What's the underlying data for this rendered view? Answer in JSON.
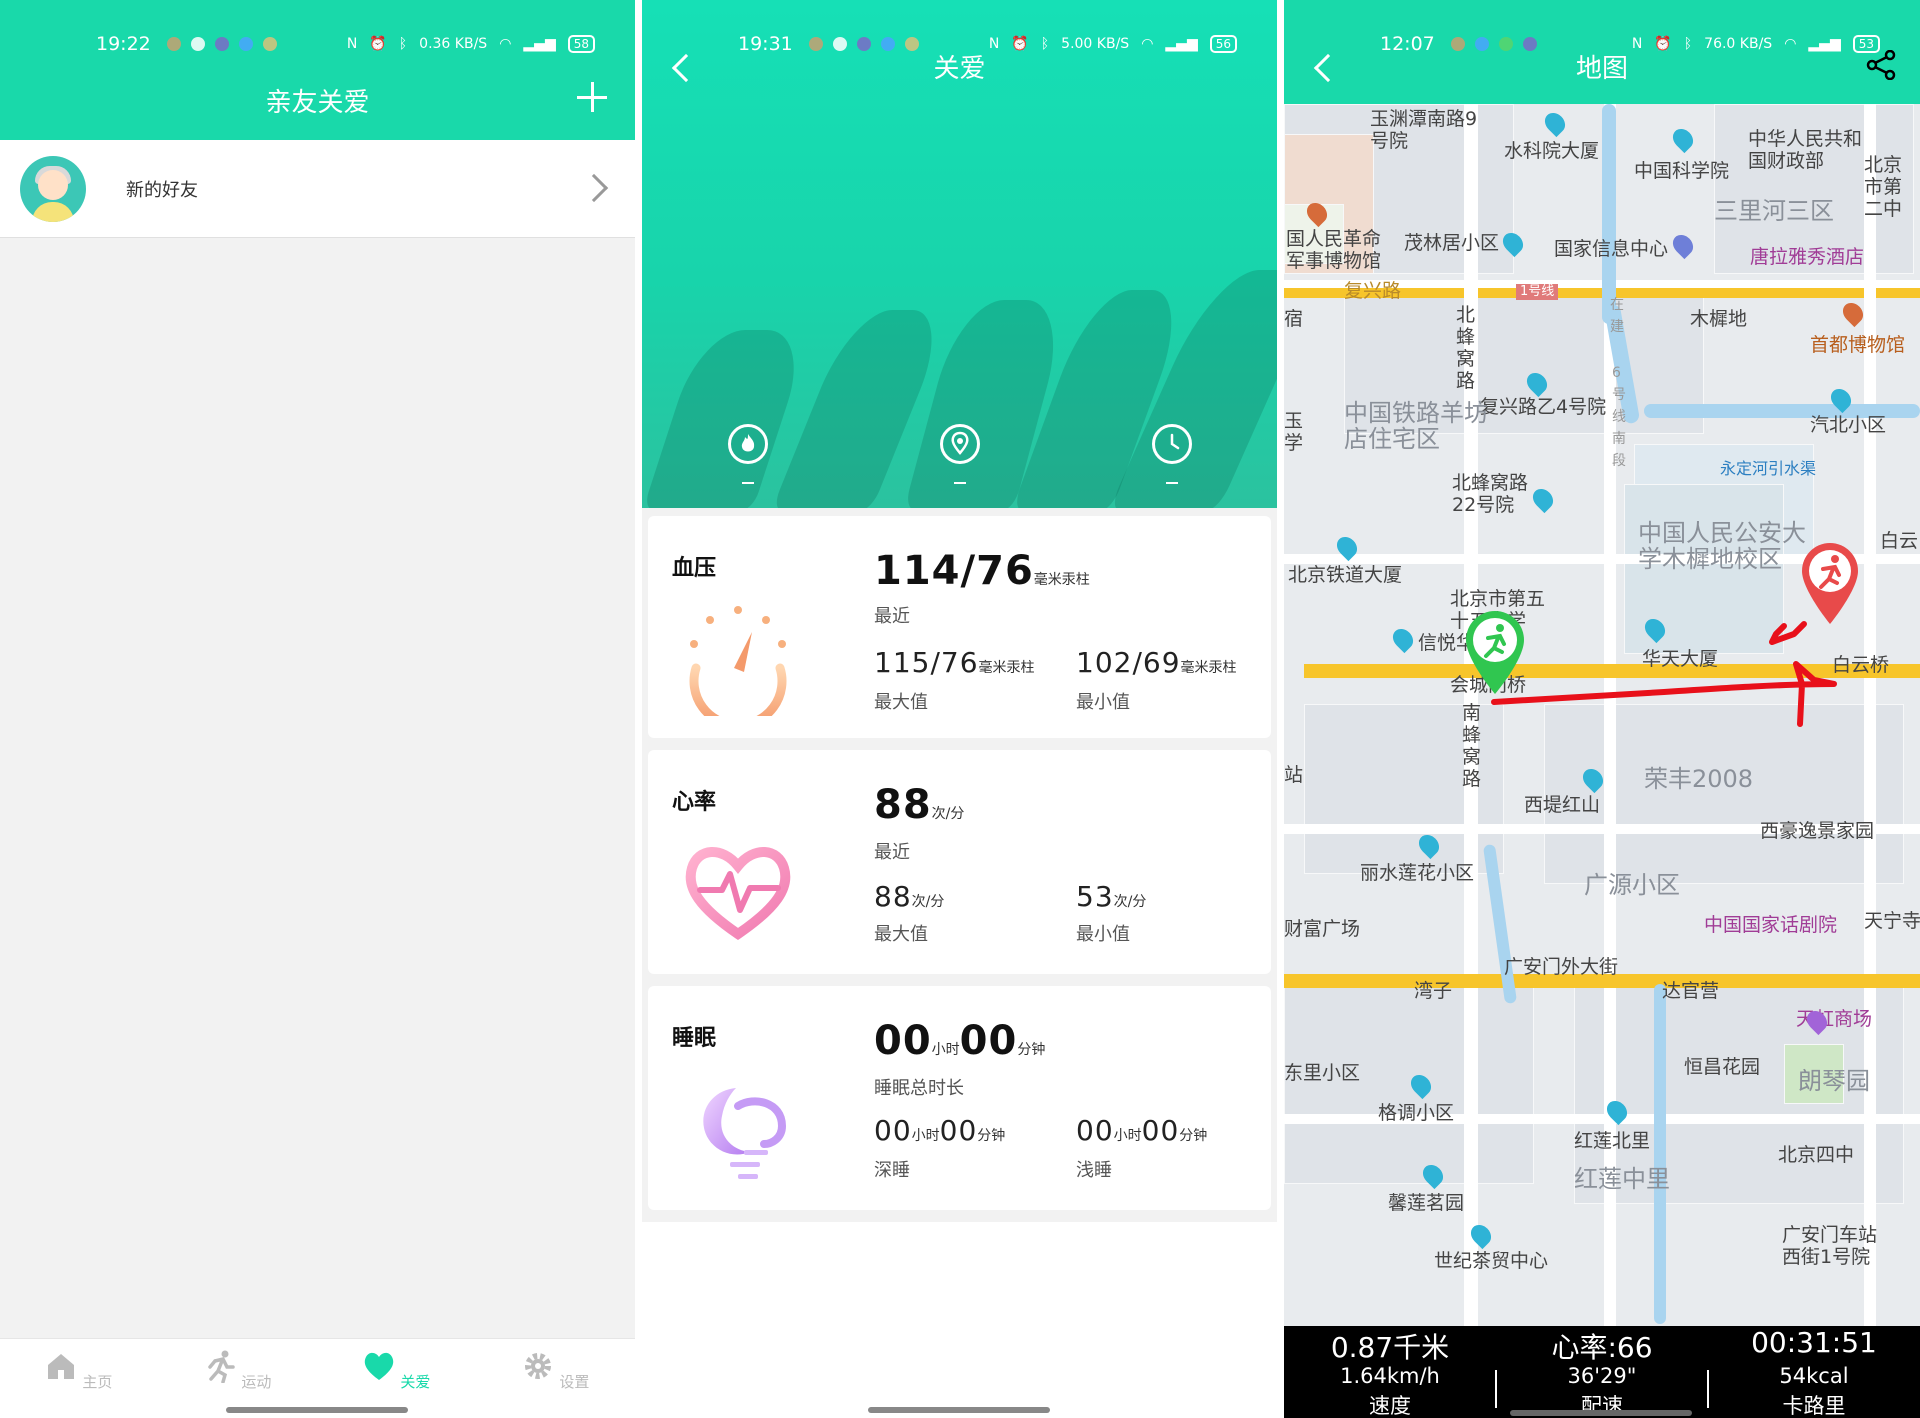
{
  "screen1": {
    "status": {
      "time": "19:22",
      "right": "0.36 KB/S",
      "battery": "58"
    },
    "title": "亲友关爱",
    "friend_label": "新的好友",
    "tabs": [
      {
        "label": "主页",
        "icon": "home-icon"
      },
      {
        "label": "运动",
        "icon": "runner-icon"
      },
      {
        "label": "关爱",
        "icon": "heart-icon",
        "active": true
      },
      {
        "label": "设置",
        "icon": "gear-icon"
      }
    ]
  },
  "screen2": {
    "status": {
      "time": "19:31",
      "right": "5.00 KB/S",
      "battery": "56"
    },
    "title": "关爱",
    "hero_values": [
      "–",
      "–",
      "–"
    ],
    "bp": {
      "title": "血压",
      "latest": "114/76",
      "unit": "毫米汞柱",
      "latest_cap": "最近",
      "max": "115/76",
      "max_cap": "最大值",
      "min": "102/69",
      "min_cap": "最小值"
    },
    "hr": {
      "title": "心率",
      "latest": "88",
      "unit": "次/分",
      "latest_cap": "最近",
      "max": "88",
      "max_cap": "最大值",
      "min": "53",
      "min_cap": "最小值"
    },
    "sleep": {
      "title": "睡眠",
      "h": "00",
      "h_unit": "小时",
      "m": "00",
      "m_unit": "分钟",
      "total_cap": "睡眠总时长",
      "deep_h": "00",
      "deep_m": "00",
      "deep_cap": "深睡",
      "light_h": "00",
      "light_m": "00",
      "light_cap": "浅睡"
    }
  },
  "screen3": {
    "status": {
      "time": "12:07",
      "right": "76.0 KB/S",
      "battery": "53"
    },
    "title": "地图",
    "labels": {
      "l1": "玉渊潭南路9号院",
      "l2": "水科院大厦",
      "l3": "中国科学院",
      "l4": "中华人民共和国财政部",
      "l5": "北京市第二中",
      "l6": "国人民革命军事博物馆",
      "l7": "茂林居小区",
      "l8": "国家信息中心",
      "l9": "三里河三区",
      "l10": "唐拉雅秀酒店",
      "l11": "复兴路",
      "l12": "1号线",
      "l13": "木樨地",
      "l14": "首都博物馆",
      "l15": "北蜂窝路",
      "l16": "在建",
      "l17": "6号线南段",
      "l18": "复兴路乙4号院",
      "l19": "中国铁路羊坊店住宅区",
      "l20": "汽北小区",
      "l21": "永定河引水渠",
      "l22": "北蜂窝路22号院",
      "l23": "中国人民公安大学木樨地校区",
      "l24": "白云",
      "l25": "北京铁道大厦",
      "l26": "北京市第五十五中学",
      "l27": "信悦华",
      "l28": "华天大厦",
      "l29": "白云桥",
      "l30": "会城门桥",
      "l31": "南蜂窝路",
      "l32": "荣丰2008",
      "l33": "西堤红山",
      "l34": "西豪逸景家园",
      "l35": "丽水莲花小区",
      "l36": "广源小区",
      "l37": "中国国家话剧院",
      "l38": "天宁寺",
      "l39": "财富广场",
      "l40": "广安门外大街",
      "l41": "湾子",
      "l42": "达官营",
      "l43": "天虹商场",
      "l44": "东里小区",
      "l45": "恒昌花园",
      "l46": "朗琴园",
      "l47": "格调小区",
      "l48": "红莲北里",
      "l49": "北京四中",
      "l50": "红莲中里",
      "l51": "馨莲茗园",
      "l52": "广安门车站西街1号院",
      "l53": "世纪茶贸中心",
      "l54": "站",
      "l55": "玉学",
      "l56": "宿"
    },
    "stats": {
      "distance": "0.87千米",
      "heart_rate": "心率:66",
      "duration": "00:31:51",
      "speed": "1.64km/h",
      "speed_cap": "速度",
      "pace": "36'29\"",
      "pace_cap": "配速",
      "calorie": "54kcal",
      "calorie_cap": "卡路里"
    }
  },
  "colors": {
    "brand": "#19d9aa",
    "route": "#e8101a",
    "road_major": "#f7c52b"
  }
}
